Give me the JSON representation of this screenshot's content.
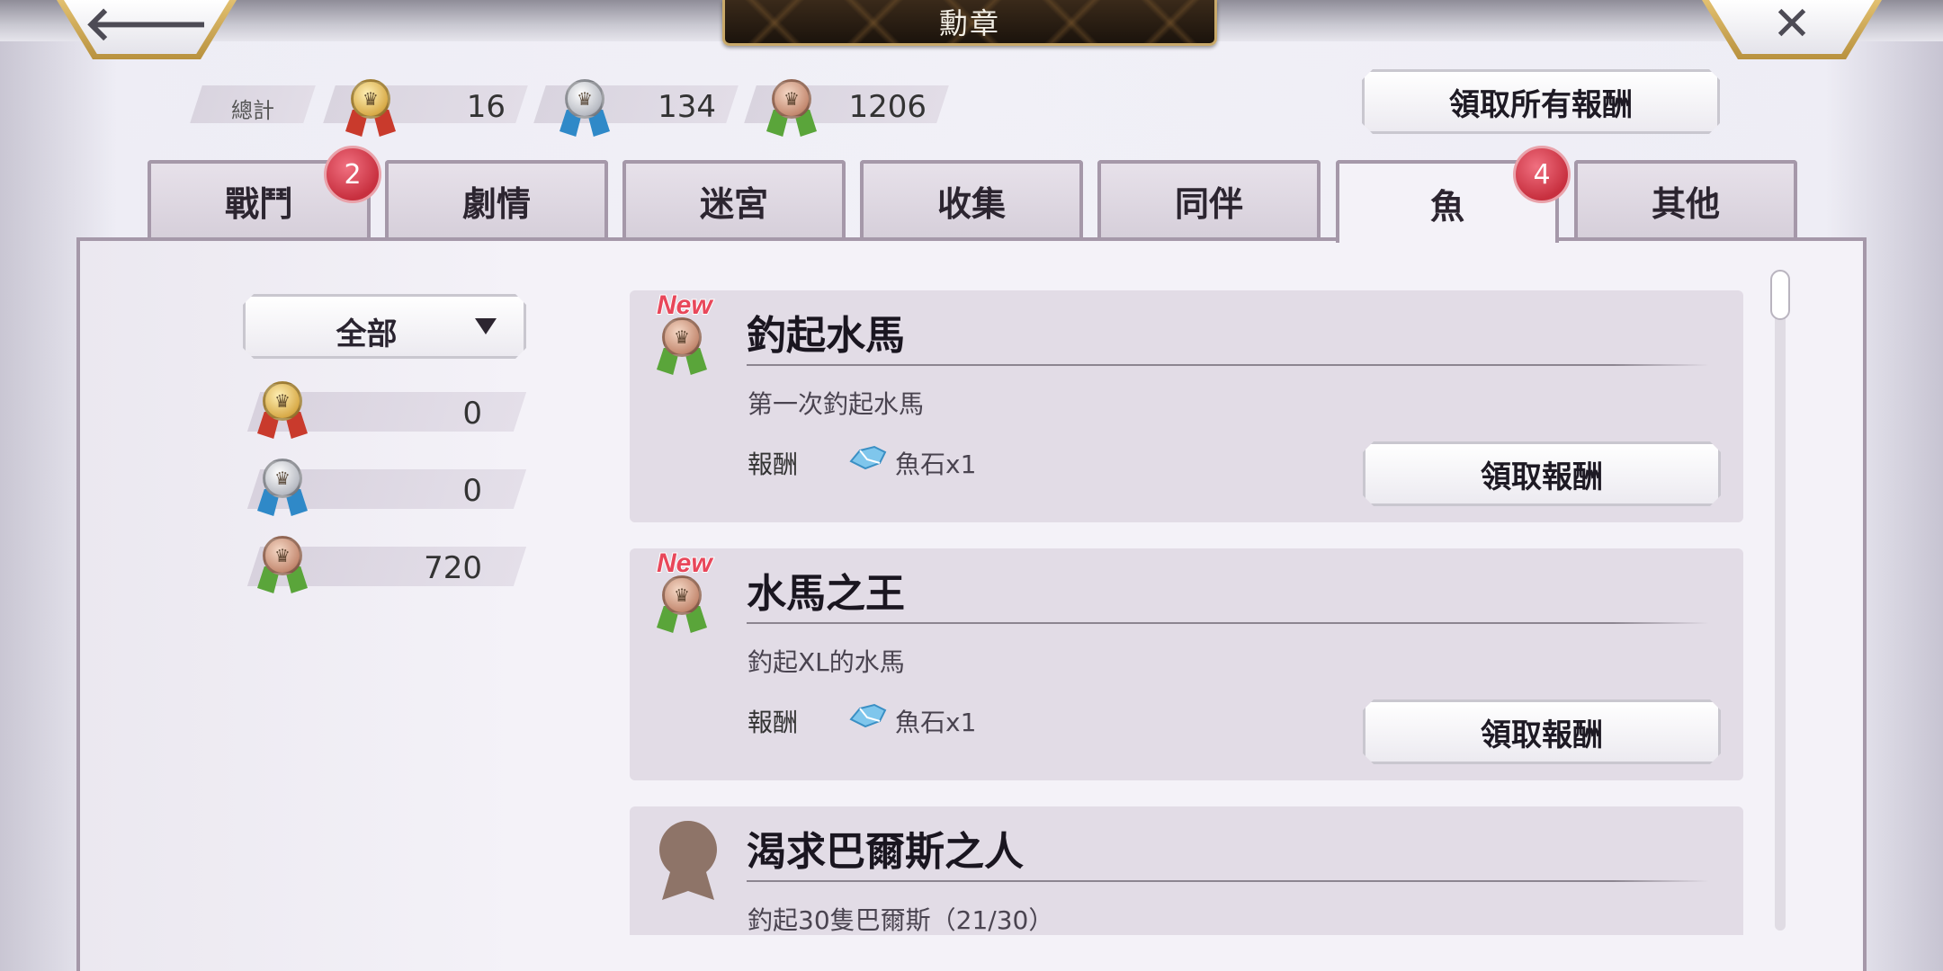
{
  "header": {
    "title": "勳章",
    "back_icon": "arrow-left",
    "close_icon": "x-mark"
  },
  "totals": {
    "label": "總計",
    "gold": "16",
    "silver": "134",
    "bronze": "1206"
  },
  "claim_all_label": "領取所有報酬",
  "tabs": [
    {
      "label": "戰鬥",
      "badge": "2"
    },
    {
      "label": "劇情"
    },
    {
      "label": "迷宮"
    },
    {
      "label": "收集"
    },
    {
      "label": "同伴"
    },
    {
      "label": "魚",
      "badge": "4",
      "active": true
    },
    {
      "label": "其他"
    }
  ],
  "filter": {
    "selected": "全部",
    "counts": {
      "gold": "0",
      "silver": "0",
      "bronze": "720"
    }
  },
  "achievements": [
    {
      "new_tag": "New",
      "title": "釣起水馬",
      "description": "第一次釣起水馬",
      "reward_label": "報酬",
      "reward_item": "魚石x1",
      "button": "領取報酬"
    },
    {
      "new_tag": "New",
      "title": "水馬之王",
      "description": "釣起XL的水馬",
      "reward_label": "報酬",
      "reward_item": "魚石x1",
      "button": "領取報酬"
    },
    {
      "title": "渴求巴爾斯之人",
      "description": "釣起30隻巴爾斯（21/30）"
    }
  ],
  "colors": {
    "accent_gold": "#c8a96a",
    "badge_red": "#c8303f",
    "tab_border": "#a598a9",
    "card_bg": "#e2dce6"
  }
}
